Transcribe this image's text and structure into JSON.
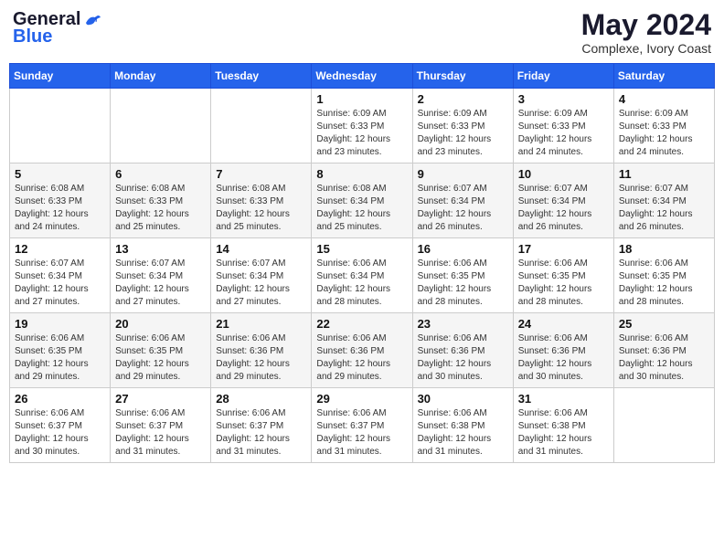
{
  "logo": {
    "line1": "General",
    "line2": "Blue"
  },
  "title": "May 2024",
  "location": "Complexe, Ivory Coast",
  "weekdays": [
    "Sunday",
    "Monday",
    "Tuesday",
    "Wednesday",
    "Thursday",
    "Friday",
    "Saturday"
  ],
  "weeks": [
    [
      {
        "day": "",
        "info": ""
      },
      {
        "day": "",
        "info": ""
      },
      {
        "day": "",
        "info": ""
      },
      {
        "day": "1",
        "info": "Sunrise: 6:09 AM\nSunset: 6:33 PM\nDaylight: 12 hours\nand 23 minutes."
      },
      {
        "day": "2",
        "info": "Sunrise: 6:09 AM\nSunset: 6:33 PM\nDaylight: 12 hours\nand 23 minutes."
      },
      {
        "day": "3",
        "info": "Sunrise: 6:09 AM\nSunset: 6:33 PM\nDaylight: 12 hours\nand 24 minutes."
      },
      {
        "day": "4",
        "info": "Sunrise: 6:09 AM\nSunset: 6:33 PM\nDaylight: 12 hours\nand 24 minutes."
      }
    ],
    [
      {
        "day": "5",
        "info": "Sunrise: 6:08 AM\nSunset: 6:33 PM\nDaylight: 12 hours\nand 24 minutes."
      },
      {
        "day": "6",
        "info": "Sunrise: 6:08 AM\nSunset: 6:33 PM\nDaylight: 12 hours\nand 25 minutes."
      },
      {
        "day": "7",
        "info": "Sunrise: 6:08 AM\nSunset: 6:33 PM\nDaylight: 12 hours\nand 25 minutes."
      },
      {
        "day": "8",
        "info": "Sunrise: 6:08 AM\nSunset: 6:34 PM\nDaylight: 12 hours\nand 25 minutes."
      },
      {
        "day": "9",
        "info": "Sunrise: 6:07 AM\nSunset: 6:34 PM\nDaylight: 12 hours\nand 26 minutes."
      },
      {
        "day": "10",
        "info": "Sunrise: 6:07 AM\nSunset: 6:34 PM\nDaylight: 12 hours\nand 26 minutes."
      },
      {
        "day": "11",
        "info": "Sunrise: 6:07 AM\nSunset: 6:34 PM\nDaylight: 12 hours\nand 26 minutes."
      }
    ],
    [
      {
        "day": "12",
        "info": "Sunrise: 6:07 AM\nSunset: 6:34 PM\nDaylight: 12 hours\nand 27 minutes."
      },
      {
        "day": "13",
        "info": "Sunrise: 6:07 AM\nSunset: 6:34 PM\nDaylight: 12 hours\nand 27 minutes."
      },
      {
        "day": "14",
        "info": "Sunrise: 6:07 AM\nSunset: 6:34 PM\nDaylight: 12 hours\nand 27 minutes."
      },
      {
        "day": "15",
        "info": "Sunrise: 6:06 AM\nSunset: 6:34 PM\nDaylight: 12 hours\nand 28 minutes."
      },
      {
        "day": "16",
        "info": "Sunrise: 6:06 AM\nSunset: 6:35 PM\nDaylight: 12 hours\nand 28 minutes."
      },
      {
        "day": "17",
        "info": "Sunrise: 6:06 AM\nSunset: 6:35 PM\nDaylight: 12 hours\nand 28 minutes."
      },
      {
        "day": "18",
        "info": "Sunrise: 6:06 AM\nSunset: 6:35 PM\nDaylight: 12 hours\nand 28 minutes."
      }
    ],
    [
      {
        "day": "19",
        "info": "Sunrise: 6:06 AM\nSunset: 6:35 PM\nDaylight: 12 hours\nand 29 minutes."
      },
      {
        "day": "20",
        "info": "Sunrise: 6:06 AM\nSunset: 6:35 PM\nDaylight: 12 hours\nand 29 minutes."
      },
      {
        "day": "21",
        "info": "Sunrise: 6:06 AM\nSunset: 6:36 PM\nDaylight: 12 hours\nand 29 minutes."
      },
      {
        "day": "22",
        "info": "Sunrise: 6:06 AM\nSunset: 6:36 PM\nDaylight: 12 hours\nand 29 minutes."
      },
      {
        "day": "23",
        "info": "Sunrise: 6:06 AM\nSunset: 6:36 PM\nDaylight: 12 hours\nand 30 minutes."
      },
      {
        "day": "24",
        "info": "Sunrise: 6:06 AM\nSunset: 6:36 PM\nDaylight: 12 hours\nand 30 minutes."
      },
      {
        "day": "25",
        "info": "Sunrise: 6:06 AM\nSunset: 6:36 PM\nDaylight: 12 hours\nand 30 minutes."
      }
    ],
    [
      {
        "day": "26",
        "info": "Sunrise: 6:06 AM\nSunset: 6:37 PM\nDaylight: 12 hours\nand 30 minutes."
      },
      {
        "day": "27",
        "info": "Sunrise: 6:06 AM\nSunset: 6:37 PM\nDaylight: 12 hours\nand 31 minutes."
      },
      {
        "day": "28",
        "info": "Sunrise: 6:06 AM\nSunset: 6:37 PM\nDaylight: 12 hours\nand 31 minutes."
      },
      {
        "day": "29",
        "info": "Sunrise: 6:06 AM\nSunset: 6:37 PM\nDaylight: 12 hours\nand 31 minutes."
      },
      {
        "day": "30",
        "info": "Sunrise: 6:06 AM\nSunset: 6:38 PM\nDaylight: 12 hours\nand 31 minutes."
      },
      {
        "day": "31",
        "info": "Sunrise: 6:06 AM\nSunset: 6:38 PM\nDaylight: 12 hours\nand 31 minutes."
      },
      {
        "day": "",
        "info": ""
      }
    ]
  ]
}
